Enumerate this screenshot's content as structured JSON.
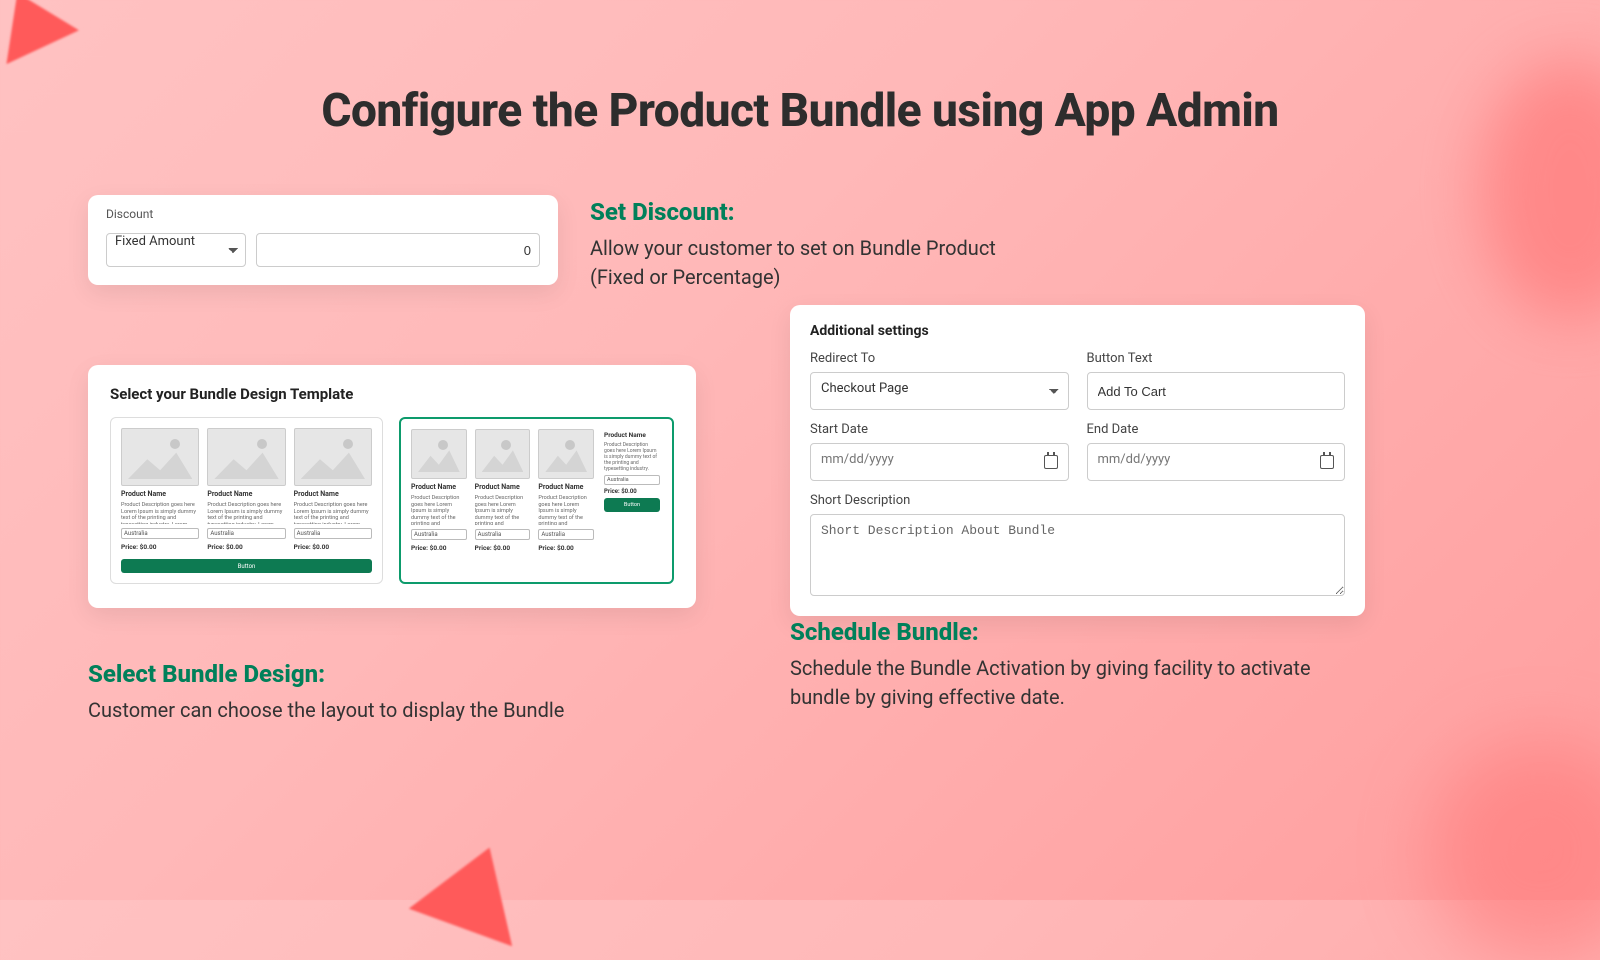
{
  "page_title": "Configure the Product Bundle using App Admin",
  "discount": {
    "label": "Discount",
    "type_option": "Fixed Amount",
    "value": "0"
  },
  "set_discount": {
    "title": "Set Discount:",
    "text": "Allow your customer to set on Bundle Product (Fixed or Percentage)"
  },
  "template": {
    "label": "Select your Bundle Design Template",
    "product_name": "Product Name",
    "desc": "Product Description goes here Lorem Ipsum is simply dummy text of the printing and typesetting industry. Lorem Ipsum has been the industry's standard",
    "select_opt": "Australia",
    "price": "Price: $0.00",
    "btn": "Button"
  },
  "select_design": {
    "title": "Select Bundle Design:",
    "text": "Customer can choose the layout to display the Bundle"
  },
  "settings": {
    "heading": "Additional settings",
    "redirect_label": "Redirect To",
    "redirect_value": "Checkout Page",
    "btn_text_label": "Button Text",
    "btn_text_value": "Add To Cart",
    "start_label": "Start Date",
    "end_label": "End Date",
    "date_placeholder": "mm/dd/yyyy",
    "short_desc_label": "Short Description",
    "short_desc_value": "Short Description About Bundle"
  },
  "schedule": {
    "title": "Schedule Bundle:",
    "text": "Schedule the Bundle Activation by giving facility to activate bundle by giving effective date."
  }
}
